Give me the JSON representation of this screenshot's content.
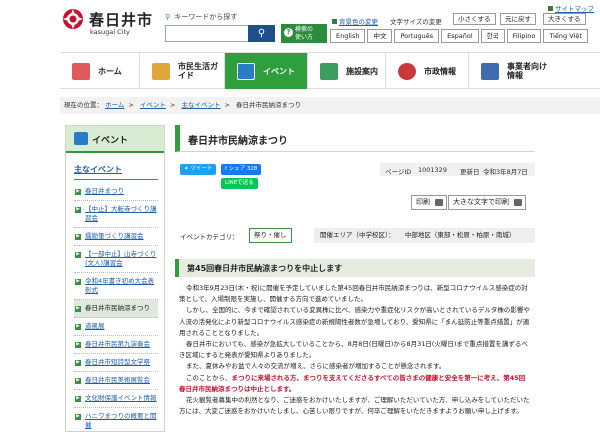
{
  "header": {
    "logo_name": "春日井市",
    "logo_sub": "kasugai City",
    "search_hint": "キーワードから探す",
    "search_placeholder": "",
    "search_help": [
      "検索の",
      "使い方"
    ],
    "sitemap": "サイトマップ",
    "bg_color": "背景色の変更",
    "text_size_label": "文字サイズの変更",
    "text_sizes": [
      "小さくする",
      "元に戻す",
      "大きくする"
    ],
    "languages": [
      "English",
      "中文",
      "Português",
      "Español",
      "한국",
      "Filipino",
      "Tiếng Việt"
    ]
  },
  "nav": [
    {
      "label": "ホーム",
      "icon": "home-icon",
      "color": "#e05a5a"
    },
    {
      "label": "市民生活ガイド",
      "icon": "guide-icon",
      "color": "#e0a73a"
    },
    {
      "label": "イベント",
      "icon": "calendar-icon",
      "color": "#2a7cc7",
      "active": true
    },
    {
      "label": "施設案内",
      "icon": "building-icon",
      "color": "#3a9d5d"
    },
    {
      "label": "市政情報",
      "icon": "city-hall-icon",
      "color": "#c83a3a"
    },
    {
      "label": "事業者向け情報",
      "icon": "business-icon",
      "color": "#3f6bb0"
    }
  ],
  "breadcrumb": {
    "prefix": "現在の位置：",
    "items": [
      "ホーム",
      "イベント",
      "主なイベント"
    ],
    "current": "春日井市民納涼まつり"
  },
  "sidebar": {
    "title": "イベント",
    "subtitle": "主なイベント",
    "items": [
      {
        "label": "春日井まつり",
        "link": true
      },
      {
        "label": "【中止】大転寺づくり講習会",
        "link": true
      },
      {
        "label": "擂勘筆づくり講習会",
        "link": true
      },
      {
        "label": "【一部中止】山寺づくり(文人)講習会",
        "link": true
      },
      {
        "label": "令和4年書き初め大会表彰式",
        "link": true
      },
      {
        "label": "春日井市民納涼まつり",
        "link": false,
        "current": true
      },
      {
        "label": "道風展",
        "link": true
      },
      {
        "label": "春日井市民第九演奏会",
        "link": true
      },
      {
        "label": "春日井市短詩型文学祭",
        "link": true
      },
      {
        "label": "春日井市民美術展覧会",
        "link": true
      },
      {
        "label": "文化財保護イベント情報",
        "link": true
      },
      {
        "label": "ハニワまつりの概要と開催",
        "link": true
      }
    ]
  },
  "main": {
    "title": "春日井市民納涼まつり",
    "share": {
      "tweet": "ツイート",
      "facebook": "シェア 328",
      "line": "LINEで送る"
    },
    "page_id_label": "ページID",
    "page_id": "1001329",
    "updated_label": "更新日",
    "updated": "令和3年8月7日",
    "print_label": "印刷",
    "print_large_label": "大きな文字で印刷",
    "category_label": "イベントカテゴリ：",
    "category_value": "祭り・催し",
    "area_label": "開催エリア（中学校区）：",
    "area_value": "中部地区（東部・松原・柏原・南城）",
    "section_title": "第45回春日井市民納涼まつりを中止します",
    "paragraphs": [
      "令和3年9月23日(木・祝)に開催を予定していました第45回春日井市民納涼まつりは、新型コロナウイルス感染症の対策として、入場制限を実施し、開催する方向で進めていました。",
      "しかし、全国的に、今まで確認されている変異株に比べ、感染力や重症化リスクが高いとされているデルタ株の影響や人流の活発化により新型コロナウイルス感染症の新規陽性者数が急増しており、愛知県に「まん延防止等重点措置」が適用されることとなりました。",
      "春日井市においても、感染が急拡大していることから、8月8日(日曜日)から8月31日(火曜日)まで重点措置を講ずるべき区域にすると発表が愛知県よりありました。",
      "また、夏休みやお盆で人々の交流が増え、さらに感染者が増加することが懸念されます。"
    ],
    "para_red_prefix": "このことから、",
    "para_red": "まつりに来場される方、まつりを支えてくださるすべての皆さまの健康と安全を第一に考え、第45回春日井市民納涼まつりは中止とします。",
    "para_last": "花火観覧者募集中の利然となり、ご迷惑をおかけいたしますが、ご理解いただいていた方、申し込みをしていただいた方には、大変ご迷惑をおかけいたしまし、心苦しい限りですが、何卒ご理解をいただきますようお願い申し上げます。"
  },
  "colors": {
    "accent": "#2f9e3c",
    "link": "#1f5fa8",
    "search": "#1c4f8c",
    "alert": "#c8102e"
  }
}
